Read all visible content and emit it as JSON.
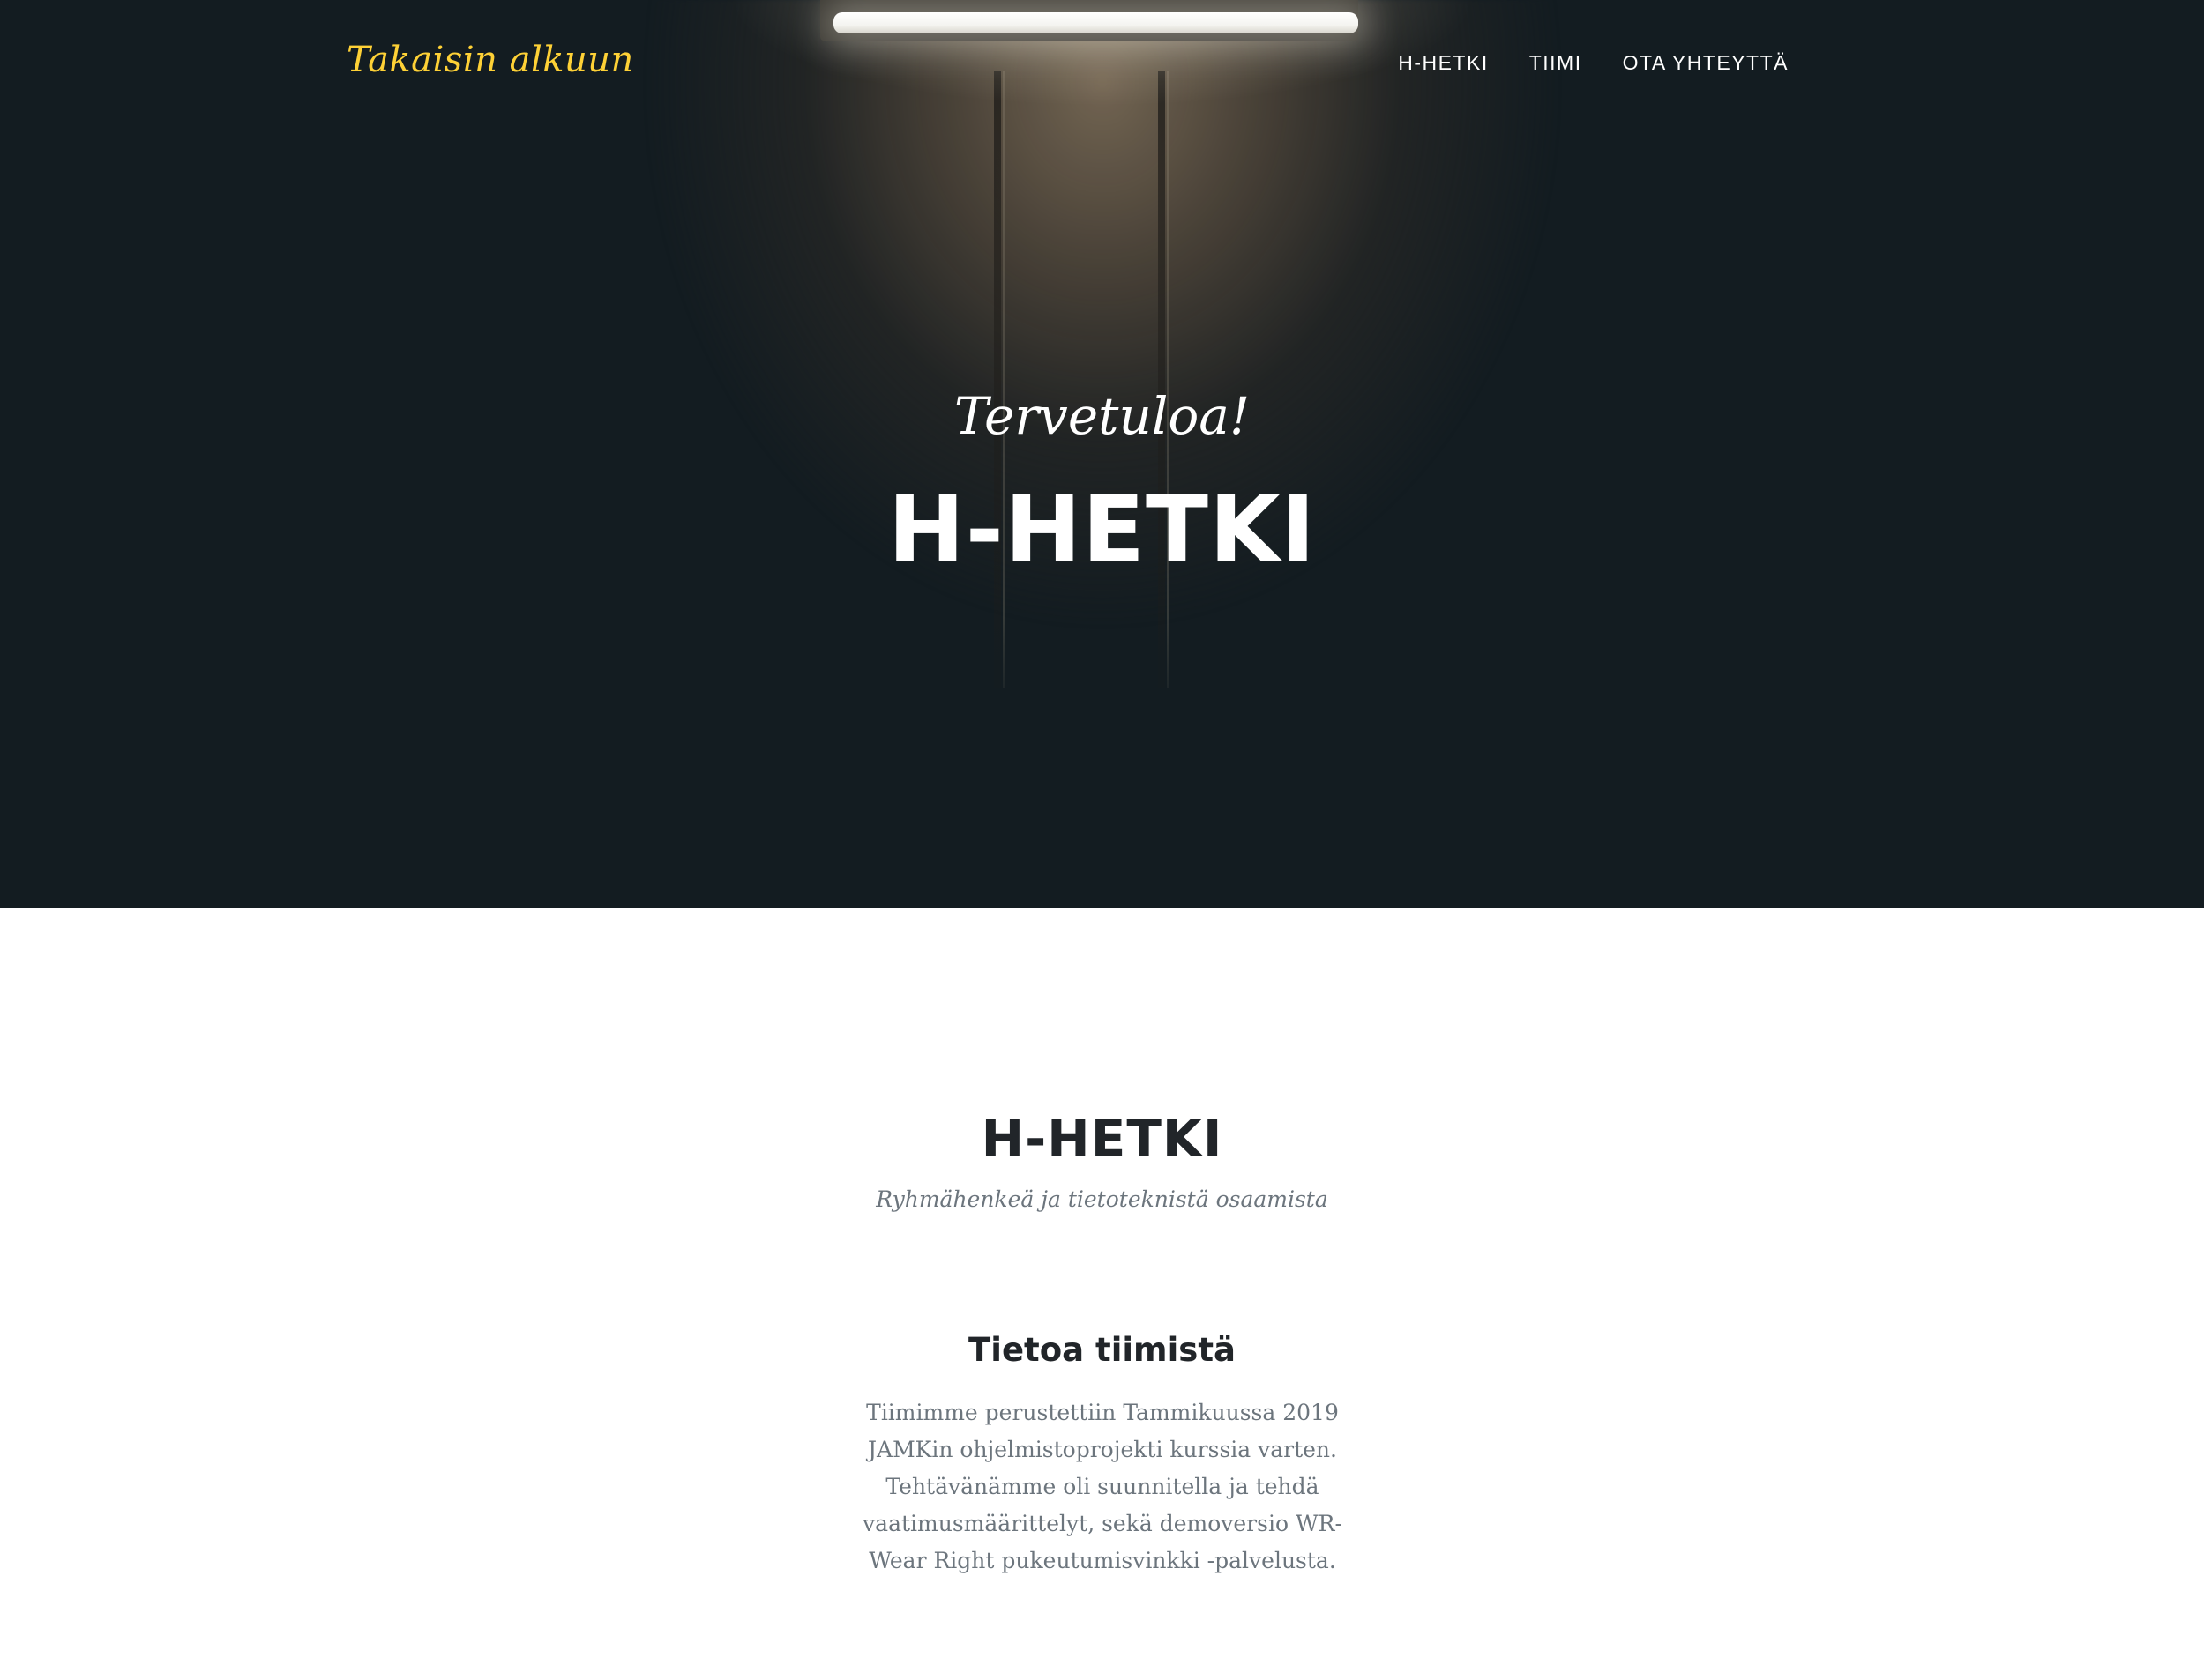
{
  "navbar": {
    "brand": "Takaisin alkuun",
    "links": [
      "H-HETKI",
      "TIIMI",
      "OTA YHTEYTTÄ"
    ]
  },
  "hero": {
    "lead": "Tervetuloa!",
    "heading": "H-HETKI"
  },
  "about": {
    "heading": "H-HETKI",
    "subheading": "Ryhmähenkeä ja tietoteknistä osaamista",
    "title": "Tietoa tiimistä",
    "text": "Tiimimme perustettiin Tammikuussa 2019 JAMKin ohjelmistoprojekti kurssia varten. Tehtävänämme oli suunnitella ja tehdä vaatimusmäärittelyt, sekä demoversio WR-Wear Right pukeutumisvinkki -palvelusta."
  },
  "colors": {
    "brand": "#fed136",
    "hero_bg": "#131c21",
    "heading": "#212529",
    "muted": "#6c757d"
  }
}
